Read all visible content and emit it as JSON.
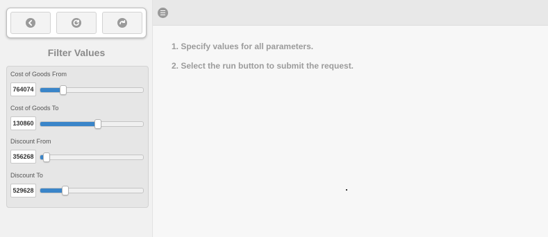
{
  "toolbar": {
    "buttons": [
      {
        "icon": "back-icon"
      },
      {
        "icon": "refresh-icon"
      },
      {
        "icon": "forward-icon"
      }
    ]
  },
  "sidebar": {
    "title": "Filter Values",
    "filters": [
      {
        "label": "Cost of Goods From",
        "value": "764074",
        "slider_fraction": 0.22
      },
      {
        "label": "Cost of Goods To",
        "value": "130860",
        "slider_fraction": 0.56
      },
      {
        "label": "Discount From",
        "value": "356268",
        "slider_fraction": 0.06
      },
      {
        "label": "Discount To",
        "value": "529628",
        "slider_fraction": 0.24
      }
    ]
  },
  "header": {
    "menu_icon": "menu-icon"
  },
  "main": {
    "instructions": [
      "1. Specify values for all parameters.",
      "2. Select the run button to submit the request."
    ]
  },
  "colors": {
    "accent": "#3a85c9",
    "sidebar_bg": "#f1f1f1",
    "panel_bg": "#e6e6e6",
    "header_bg": "#e8e8e8",
    "content_bg": "#f7f7f7",
    "instruction_text": "#9b9b9b"
  }
}
